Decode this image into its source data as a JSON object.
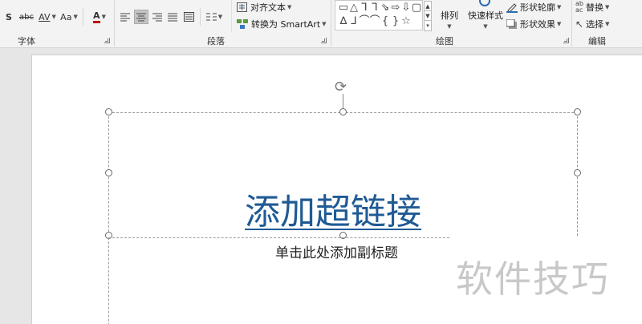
{
  "ribbon": {
    "font_group": {
      "label": "字体",
      "shadow_icon": "S",
      "strike_icon": "abc",
      "spacing_icon": "AV",
      "case_icon": "Aa",
      "color_icon": "A",
      "accent_color": "#c00000"
    },
    "paragraph_group": {
      "label": "段落",
      "align_text_label": "对齐文本",
      "convert_smartart_label": "转换为 SmartArt"
    },
    "drawing_group": {
      "label": "绘图",
      "arrange_label": "排列",
      "quick_styles_label": "快速样式",
      "shape_outline_label": "形状轮廓",
      "shape_effects_label": "形状效果",
      "shape_glyphs": [
        "▭",
        "△",
        "⅂",
        "⅂",
        "⇘",
        "⇨",
        "⇩",
        "▢",
        "∆",
        "⅃",
        "⌒",
        "⌒",
        "{",
        "}",
        "☆"
      ]
    },
    "edit_group": {
      "label": "编辑",
      "replace_label": "替换",
      "select_label": "选择"
    }
  },
  "slide": {
    "title_text": "添加超链接",
    "subtitle_placeholder": "单击此处添加副标题",
    "link_color": "#1f5a95"
  },
  "watermark": {
    "text": "软件技巧"
  }
}
